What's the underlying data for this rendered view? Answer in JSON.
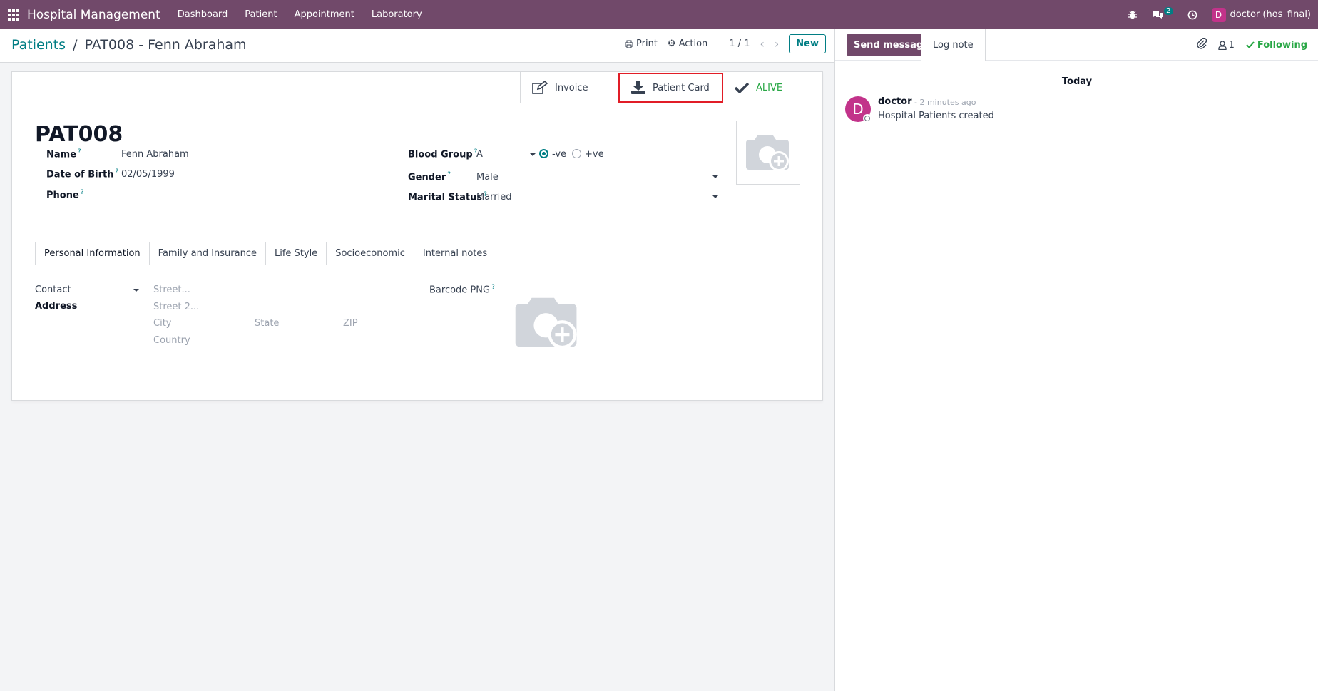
{
  "navbar": {
    "brand": "Hospital Management",
    "menu": [
      "Dashboard",
      "Patient",
      "Appointment",
      "Laboratory"
    ],
    "messages_count": "2",
    "user_initial": "D",
    "user_name": "doctor (hos_final)"
  },
  "control_panel": {
    "breadcrumb_parent": "Patients",
    "breadcrumb_sep": "/",
    "breadcrumb_current": "PAT008 - Fenn Abraham",
    "print_label": "Print",
    "action_label": "Action",
    "pager": "1 / 1",
    "new_label": "New"
  },
  "smart_buttons": {
    "invoice": "Invoice",
    "patient_card": "Patient Card",
    "status": "ALIVE"
  },
  "form": {
    "title": "PAT008",
    "name_label": "Name",
    "name_value": "Fenn Abraham",
    "dob_label": "Date of Birth",
    "dob_value": "02/05/1999",
    "phone_label": "Phone",
    "blood_group_label": "Blood Group",
    "blood_group_value": "A",
    "rh_negative": "-ve",
    "rh_positive": "+ve",
    "gender_label": "Gender",
    "gender_value": "Male",
    "marital_label": "Marital Status",
    "marital_value": "Married",
    "help_mark": "?"
  },
  "tabs": [
    "Personal Information",
    "Family and Insurance",
    "Life Style",
    "Socioeconomic",
    "Internal notes"
  ],
  "personal_info": {
    "contact_value": "Contact",
    "address_label": "Address",
    "street_ph": "Street...",
    "street2_ph": "Street 2...",
    "city_ph": "City",
    "state_ph": "State",
    "zip_ph": "ZIP",
    "country_ph": "Country",
    "barcode_label": "Barcode PNG"
  },
  "chatter": {
    "send_message": "Send message",
    "log_note": "Log note",
    "followers_count": "1",
    "following": "Following",
    "date_separator": "Today",
    "message": {
      "avatar_initial": "D",
      "author": "doctor",
      "time": "- 2 minutes ago",
      "body": "Hospital Patients created"
    }
  },
  "colors": {
    "brand": "#71496a",
    "accent": "#017e84",
    "success": "#28a745",
    "highlight_border": "#e11d27",
    "avatar": "#c2338a"
  }
}
